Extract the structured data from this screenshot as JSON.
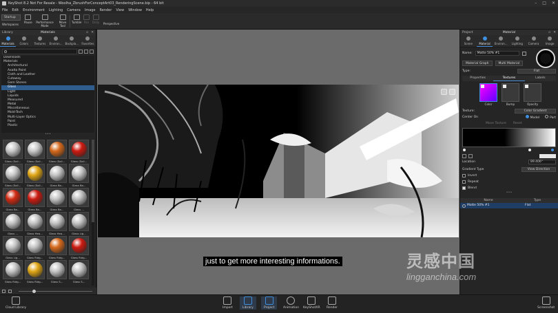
{
  "window": {
    "title": "KeyShot 8.2 Not For Resale - Woolha_ZbrushForConceptArt03_RenderingScene.bip - 64 bit"
  },
  "menu": [
    "File",
    "Edit",
    "Environment",
    "Lighting",
    "Camera",
    "Image",
    "Render",
    "View",
    "Window",
    "Help"
  ],
  "toolbar": {
    "workspace_select": "Startup",
    "workspaces": "Workspaces",
    "pause": "Pause",
    "performance_mode": "Performance Mode",
    "move_tool": "Move Tool",
    "tumble": "Tumble",
    "pan": "Pan",
    "dolly": "Dolly",
    "perspective": "Perspective"
  },
  "library": {
    "header_left": "Library",
    "header_title": "Materials",
    "tabs": [
      "Materials",
      "Colors",
      "Textures",
      "Environ...",
      "Backpla...",
      "Favorites"
    ],
    "tree": [
      {
        "label": "Downloads",
        "level": 0
      },
      {
        "label": "Materials",
        "level": 0
      },
      {
        "label": "Architectural",
        "level": 1
      },
      {
        "label": "Axalta Paint",
        "level": 1
      },
      {
        "label": "Cloth and Leather",
        "level": 1
      },
      {
        "label": "Cutaway",
        "level": 1
      },
      {
        "label": "Gem Stones",
        "level": 1
      },
      {
        "label": "Glass",
        "level": 1,
        "selected": true
      },
      {
        "label": "Light",
        "level": 1
      },
      {
        "label": "Liquids",
        "level": 1
      },
      {
        "label": "Measured",
        "level": 1
      },
      {
        "label": "Metal",
        "level": 1
      },
      {
        "label": "Miscellaneous",
        "level": 1
      },
      {
        "label": "Mold-Tech",
        "level": 1
      },
      {
        "label": "Multi-Layer Optics",
        "level": 1
      },
      {
        "label": "Paint",
        "level": 1
      },
      {
        "label": "Plastic",
        "level": 1
      }
    ],
    "materials": [
      {
        "name": "Glass (Soli...",
        "color": "#c9c9c9"
      },
      {
        "name": "Glass (Soli...",
        "color": "#c9c9c9"
      },
      {
        "name": "Glass (Soli...",
        "color": "#d4681c"
      },
      {
        "name": "Glass (Soli...",
        "color": "#cc1a10"
      },
      {
        "name": "Glass (Soli...",
        "color": "#c9c9c9"
      },
      {
        "name": "Glass (Soli...",
        "color": "#e0a615"
      },
      {
        "name": "Glass Ba...",
        "color": "#c4c4c4"
      },
      {
        "name": "Glass Ba...",
        "color": "#c4c4c4"
      },
      {
        "name": "Glass Ba...",
        "color": "#d02a12"
      },
      {
        "name": "Glass Ba...",
        "color": "#cc1a10"
      },
      {
        "name": "Glass Ba...",
        "color": "#c4c4c4"
      },
      {
        "name": "Glass ...",
        "color": "#bdbdbd"
      },
      {
        "name": "Glass ...",
        "color": "#c4c4c4"
      },
      {
        "name": "Glass Hea...",
        "color": "#c4c4c4"
      },
      {
        "name": "Glass Hea...",
        "color": "#c4c4c4"
      },
      {
        "name": "Glass Lig...",
        "color": "#c4c4c4"
      },
      {
        "name": "Glass Lig...",
        "color": "#c4c4c4"
      },
      {
        "name": "Glass Ridg...",
        "color": "#c4c4c4"
      },
      {
        "name": "Glass Ridg...",
        "color": "#d4681c"
      },
      {
        "name": "Glass Ridg...",
        "color": "#cc1a10"
      },
      {
        "name": "Glass Ridg...",
        "color": "#c4c4c4"
      },
      {
        "name": "Glass Ridg...",
        "color": "#e0a615"
      },
      {
        "name": "Glass S...",
        "color": "#c4c4c4"
      },
      {
        "name": "Glass S...",
        "color": "#c4c4c4"
      }
    ],
    "footer": "Cloud Library"
  },
  "viewport": {
    "subtitle": "just to get more interesting informations."
  },
  "project": {
    "header_left": "Project",
    "header_title": "Material",
    "tabs": [
      "Scene",
      "Material",
      "Environ...",
      "Lighting",
      "Camera",
      "Image"
    ],
    "name_label": "Name:",
    "name_value": "Matte 50% #1",
    "material_graph": "Material Graph",
    "multi_material": "Multi Material",
    "type_label": "Type:",
    "type_value": "Flat",
    "subtabs": [
      "Properties",
      "Textures",
      "Labels"
    ],
    "texture_slots": [
      "Color",
      "Bump",
      "Opacity"
    ],
    "texture_label": "Texture:",
    "texture_value": "Color Gradient",
    "center_on": "Center On",
    "model": "Model",
    "part": "Part",
    "move_texture": "Move Texture",
    "reset": "Reset",
    "location_label": "Location",
    "location_value": "89.406°",
    "gradient_type_label": "Gradient Type",
    "gradient_type_value": "View Direction",
    "invert": "Invert",
    "repeat": "Repeat",
    "blend": "Blend",
    "list_headers": [
      "Name",
      "Type"
    ],
    "list_row": {
      "name": "Matte 50% #1",
      "type": "Flat"
    }
  },
  "bottom_bar": {
    "items": [
      "Import",
      "Library",
      "Project",
      "Animation",
      "KeyShotXR",
      "Render"
    ],
    "screenshot": "Screenshot"
  },
  "watermark": {
    "cn": "灵感中国",
    "url": "lingganchina.com"
  }
}
